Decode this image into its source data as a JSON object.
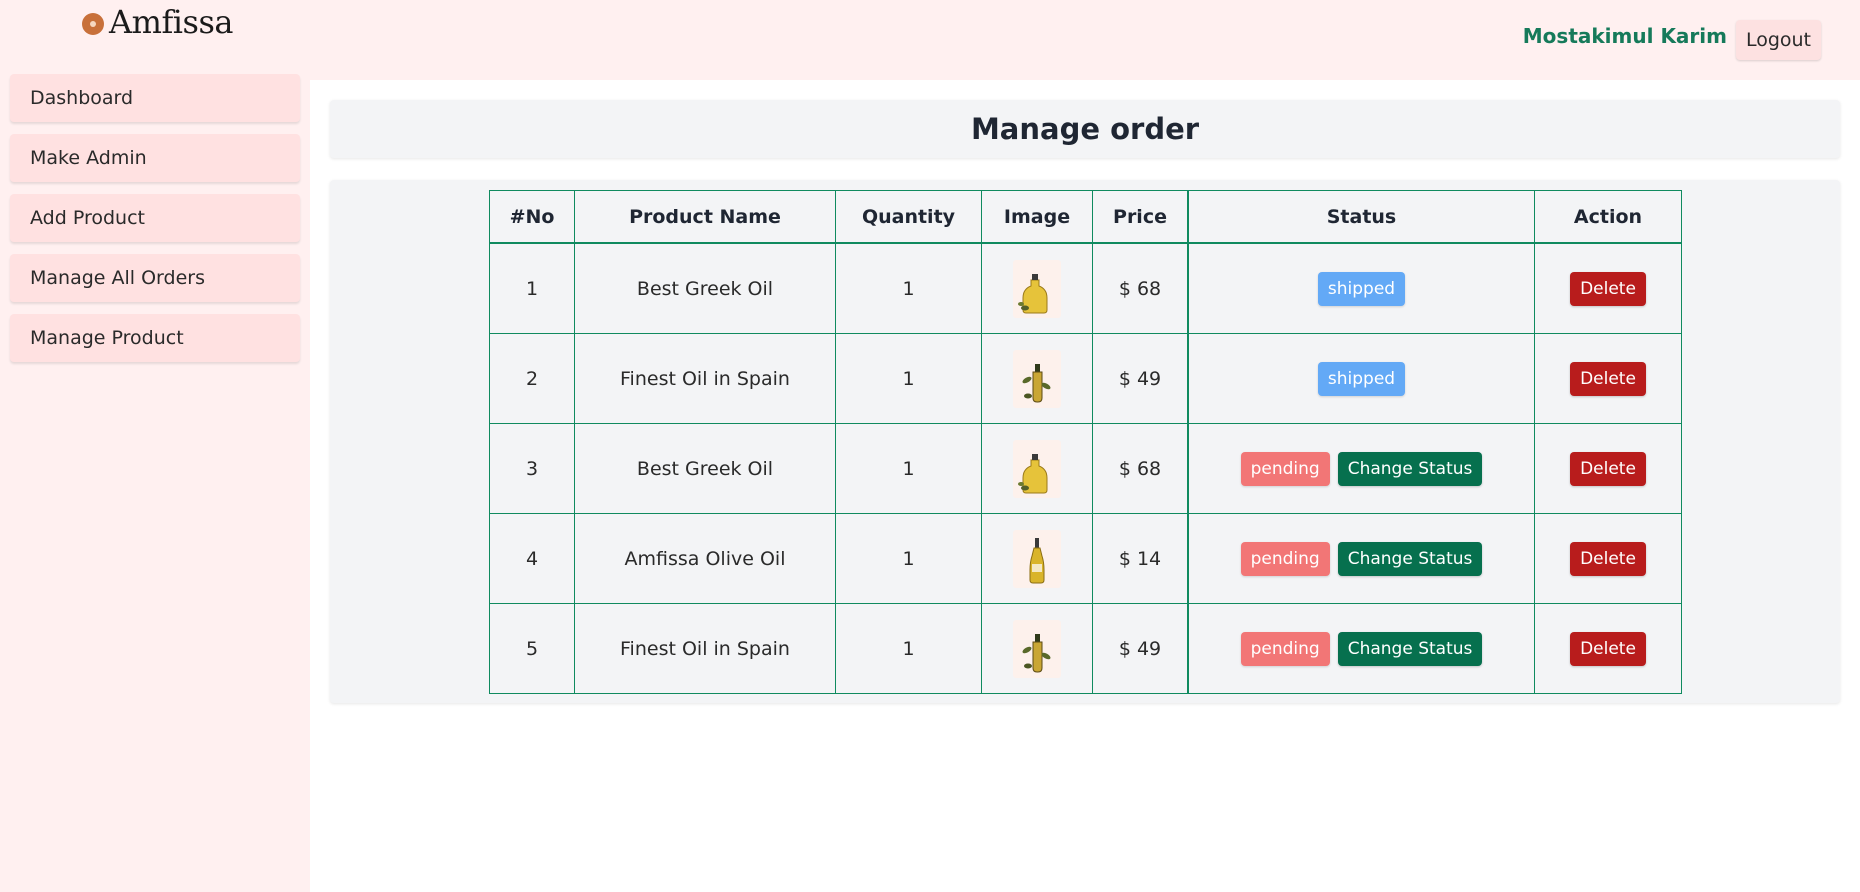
{
  "header": {
    "logo_text": "Amfissa",
    "user_name": "Mostakimul Karim",
    "logout_label": "Logout"
  },
  "sidebar": {
    "items": [
      {
        "label": "Dashboard"
      },
      {
        "label": "Make Admin"
      },
      {
        "label": "Add Product"
      },
      {
        "label": "Manage All Orders"
      },
      {
        "label": "Manage Product"
      }
    ]
  },
  "main": {
    "title": "Manage order",
    "table": {
      "columns": [
        "#No",
        "Product Name",
        "Quantity",
        "Image",
        "Price",
        "Status",
        "Action"
      ],
      "rows": [
        {
          "no": "1",
          "product": "Best Greek Oil",
          "quantity": "1",
          "image": "greek-oil-image",
          "price": "$ 68",
          "status": "shipped",
          "change_label": "",
          "delete_label": "Delete"
        },
        {
          "no": "2",
          "product": "Finest Oil in Spain",
          "quantity": "1",
          "image": "spain-oil-image",
          "price": "$ 49",
          "status": "shipped",
          "change_label": "",
          "delete_label": "Delete"
        },
        {
          "no": "3",
          "product": "Best Greek Oil",
          "quantity": "1",
          "image": "greek-oil-image",
          "price": "$ 68",
          "status": "pending",
          "change_label": "Change Status",
          "delete_label": "Delete"
        },
        {
          "no": "4",
          "product": "Amfissa Olive Oil",
          "quantity": "1",
          "image": "amfissa-oil-image",
          "price": "$ 14",
          "status": "pending",
          "change_label": "Change Status",
          "delete_label": "Delete"
        },
        {
          "no": "5",
          "product": "Finest Oil in Spain",
          "quantity": "1",
          "image": "spain-oil-image",
          "price": "$ 49",
          "status": "pending",
          "change_label": "Change Status",
          "delete_label": "Delete"
        }
      ]
    }
  },
  "colors": {
    "accent_green": "#06704e",
    "shipped_badge": "#63a9f6",
    "pending_badge": "#f27676",
    "delete_button": "#b81c1c",
    "sidebar_bg": "#fff0f0"
  }
}
